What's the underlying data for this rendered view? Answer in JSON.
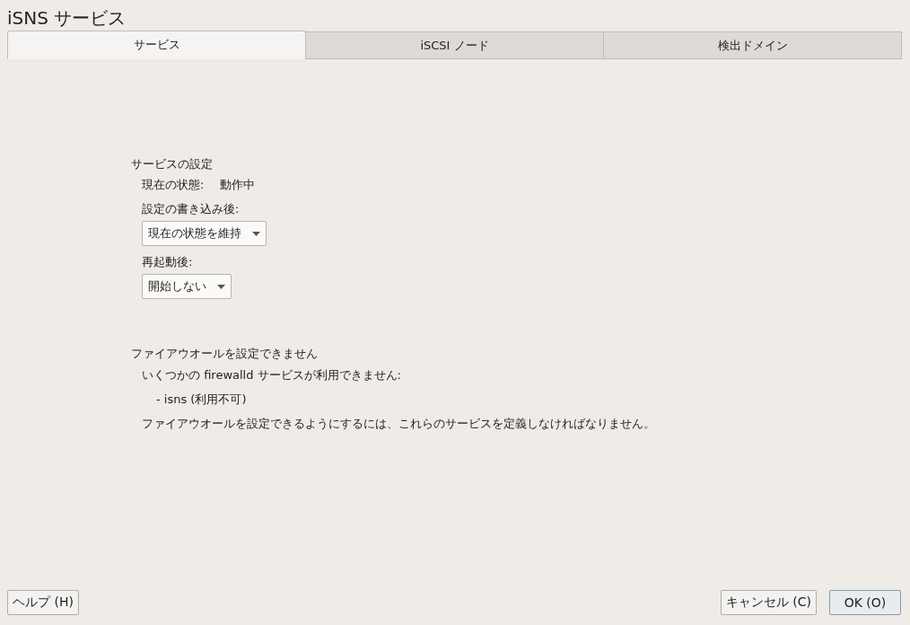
{
  "window": {
    "title": "iSNS サービス"
  },
  "tabs": [
    {
      "label": "サービス",
      "selected": true
    },
    {
      "label": "iSCSI ノード",
      "selected": false
    },
    {
      "label": "検出ドメイン",
      "selected": false
    }
  ],
  "service_settings": {
    "heading": "サービスの設定",
    "status_label": "現在の状態:",
    "status_value": "動作中",
    "after_write_label": "設定の書き込み後:",
    "after_write_value": "現在の状態を維持",
    "after_reboot_label": "再起動後:",
    "after_reboot_value": "開始しない"
  },
  "firewall": {
    "heading": "ファイアウオールを設定できません",
    "message": "いくつかの firewalld サービスが利用できません:",
    "items": [
      "- isns (利用不可)"
    ],
    "note": "ファイアウオールを設定できるようにするには、これらのサービスを定義しなければなりません。"
  },
  "buttons": {
    "help": "ヘルプ (H)",
    "cancel": "キャンセル (C)",
    "ok": "OK (O)"
  }
}
